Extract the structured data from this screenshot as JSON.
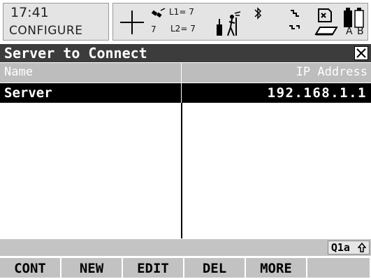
{
  "status": {
    "time": "17:41",
    "mode": "CONFIGURE",
    "satellites_main": "7",
    "l1_label": "L1= 7",
    "l2_label": "L2= 7",
    "battery_a": "A",
    "battery_b": "B"
  },
  "window": {
    "title": "Server to Connect"
  },
  "table": {
    "columns": [
      "Name",
      "IP Address"
    ],
    "rows": [
      {
        "name": "Server",
        "ip": "192.168.1.1"
      }
    ]
  },
  "input_status": "Q1a",
  "softkeys": [
    "CONT",
    "NEW",
    "EDIT",
    "DEL",
    "MORE",
    ""
  ],
  "icons": {
    "position": "crosshair-icon",
    "satellite": "satellite-icon",
    "rover": "rover-radio-icon",
    "bluetooth": "bluetooth-icon",
    "link": "link-icon",
    "storage": "memory-card-icon",
    "battery": "battery-icon",
    "close": "close-icon",
    "shift": "shift-arrow-icon"
  }
}
